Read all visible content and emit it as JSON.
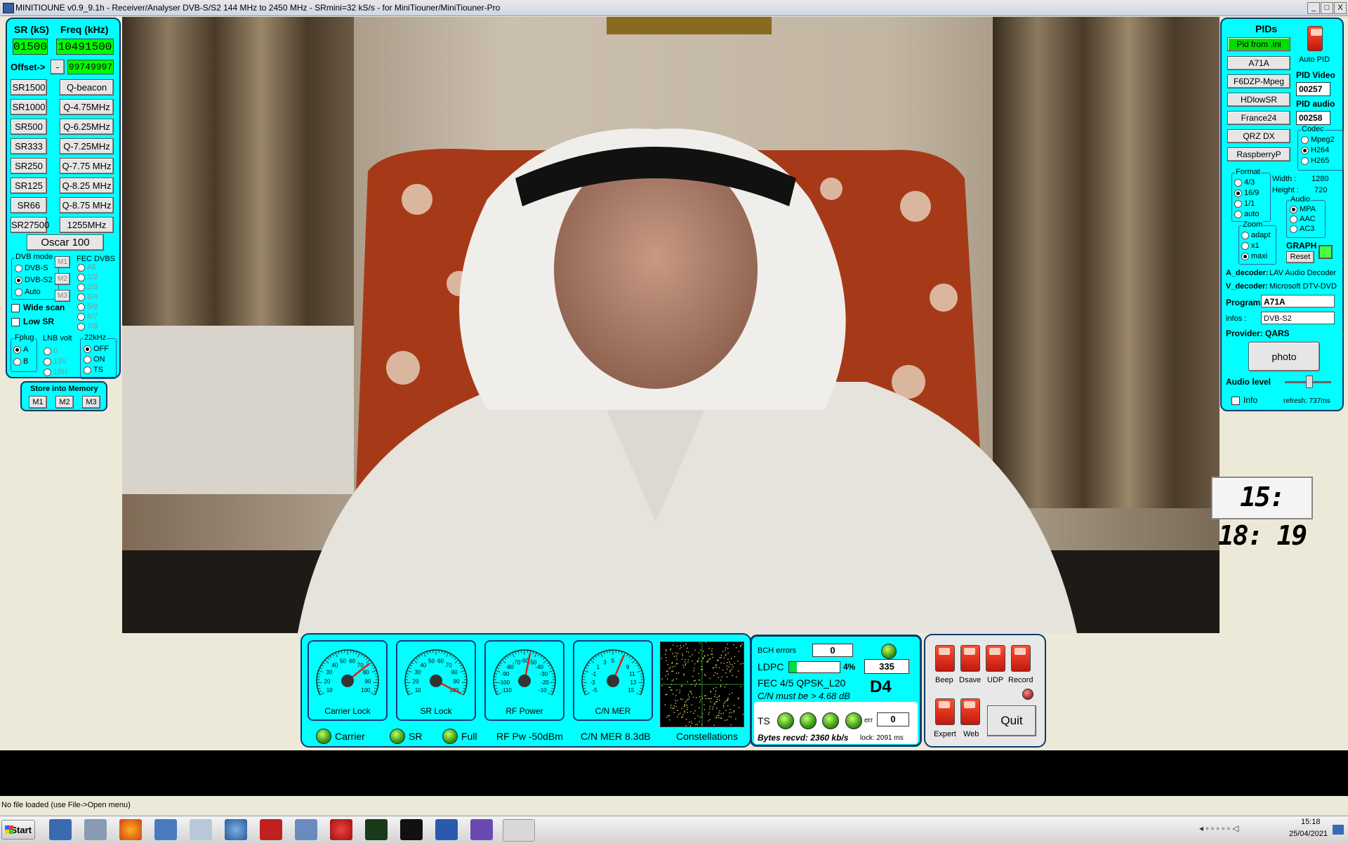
{
  "window": {
    "title": "MINITIOUNE v0.9_9.1h - Receiver/Analyser DVB-S/S2 144 MHz to 2450 MHz - SRmini=32 kS/s - for MiniTiouner/MiniTiouner-Pro",
    "min": "_",
    "max": "□",
    "close": "X"
  },
  "left": {
    "sr_label": "SR (kS)",
    "freq_label": "Freq (kHz)",
    "sr_value": "01500",
    "freq_value": "10491500",
    "offset_label": "Offset->",
    "offset_sign": "-",
    "offset_value": "09749997",
    "sr_buttons": [
      "SR1500",
      "SR1000",
      "SR500",
      "SR333",
      "SR250",
      "SR125",
      "SR66",
      "SR27500"
    ],
    "freq_buttons": [
      "Q-beacon",
      "Q-4.75MHz",
      "Q-6.25MHz",
      "Q-7.25MHz",
      "Q-7.75 MHz",
      "Q-8.25 MHz",
      "Q-8.75 MHz",
      "1255MHz"
    ],
    "oscar": "Oscar 100",
    "dvb_mode": {
      "title": "DVB mode",
      "options": [
        "DVB-S",
        "DVB-S2",
        "Auto"
      ],
      "selected": "DVB-S2"
    },
    "mem_small": [
      "M1",
      "M2",
      "M3"
    ],
    "fec": {
      "title": "FEC DVBS",
      "options": [
        "All",
        "1/2",
        "2/3",
        "3/4",
        "5/6",
        "6/7",
        "7/8"
      ]
    },
    "wide_scan": "Wide scan",
    "low_sr": "Low SR",
    "fplug": {
      "title": "Fplug",
      "options": [
        "A",
        "B"
      ],
      "selected": "A"
    },
    "lnb": {
      "title": "LNB volt",
      "options": [
        "0",
        "13V",
        "18H"
      ]
    },
    "khz22": {
      "title": "22kHz",
      "options": [
        "OFF",
        "ON",
        "TS"
      ],
      "selected": "OFF"
    },
    "store": {
      "title": "Store into Memory",
      "buttons": [
        "M1",
        "M2",
        "M3"
      ]
    }
  },
  "right": {
    "pids_title": "PIDs",
    "pid_from_ini": "Pid from .ini",
    "auto_pid": "Auto PID",
    "presets": [
      "A71A",
      "F6DZP-Mpeg",
      "HDlowSR",
      "France24",
      "QRZ DX",
      "RaspberryP"
    ],
    "pid_video_label": "PID Video",
    "pid_video": "00257",
    "pid_audio_label": "PID audio",
    "pid_audio": "00258",
    "codec": {
      "title": "Codec",
      "options": [
        "Mpeg2",
        "H264",
        "H265"
      ],
      "selected": "H264"
    },
    "format": {
      "title": "Format",
      "options": [
        "4/3",
        "16/9",
        "1/1",
        "auto"
      ],
      "selected": "16/9"
    },
    "width_label": "Width :",
    "width": "1280",
    "height_label": "Height :",
    "height": "720",
    "audio": {
      "title": "Audio",
      "options": [
        "MPA",
        "AAC",
        "AC3"
      ],
      "selected": "MPA"
    },
    "zoom": {
      "title": "Zoom",
      "options": [
        "adapt",
        "x1",
        "maxi"
      ],
      "selected": "maxi"
    },
    "graph": "GRAPH",
    "reset": "Reset",
    "a_decoder_label": "A_decoder:",
    "a_decoder": "LAV Audio Decoder",
    "v_decoder_label": "V_decoder:",
    "v_decoder": "Microsoft DTV-DVD",
    "program_label": "Program",
    "program": "A71A",
    "infos_label": "infos :",
    "infos": "DVB-S2",
    "provider": "Provider:  QARS",
    "photo": "photo",
    "audio_level": "Audio level",
    "info": "Info",
    "refresh": "refresh:  737ms"
  },
  "clock": "15: 18: 19",
  "gauges": [
    {
      "label": "Carrier Lock",
      "ticks": [
        "10",
        "20",
        "30",
        "40",
        "50",
        "60",
        "70",
        "80",
        "90",
        "100"
      ],
      "level": 0.72
    },
    {
      "label": "SR Lock",
      "ticks": [
        "10",
        "20",
        "30",
        "40",
        "50",
        "60",
        "70",
        "80",
        "90",
        "100"
      ],
      "level": 1.0
    },
    {
      "label": "RF Power",
      "ticks": [
        "-110",
        "-100",
        "-90",
        "-80",
        "-70",
        "-60",
        "-50",
        "-40",
        "-30",
        "-20",
        "-10"
      ],
      "level": 0.55
    },
    {
      "label": "C/N MER",
      "ticks": [
        "-5",
        "-3",
        "-1",
        "1",
        "3",
        "5",
        "7",
        "9",
        "11",
        "13",
        "15"
      ],
      "level": 0.6
    }
  ],
  "status": {
    "carrier": "Carrier",
    "sr": "SR",
    "full": "Full",
    "rf_pw": "RF Pw -50dBm",
    "cn_mer": "C/N MER 8.3dB",
    "constellations": "Constellations"
  },
  "decoder": {
    "bch_label": "BCH errors",
    "bch": "0",
    "ldpc_label": "LDPC",
    "ldpc_pct": "4%",
    "ldpc_value": "335",
    "ldpc_fill": 0.15,
    "fec": "FEC  4/5 QPSK_L20",
    "cn_must": "C/N must be > 4.68 dB",
    "d4": "D4",
    "ts_label": "TS",
    "err_label": "err",
    "err": "0",
    "bytes": "Bytes recvd: 2360 kb/s",
    "lock": "lock: 2091 ms"
  },
  "controls": {
    "beep": "Beep",
    "dsave": "Dsave",
    "udp": "UDP",
    "record": "Record",
    "expert": "Expert",
    "web": "Web",
    "quit": "Quit"
  },
  "statusbar": "No file loaded (use File->Open menu)",
  "taskbar": {
    "start": "Start",
    "time": "15:18",
    "date": "25/04/2021"
  }
}
